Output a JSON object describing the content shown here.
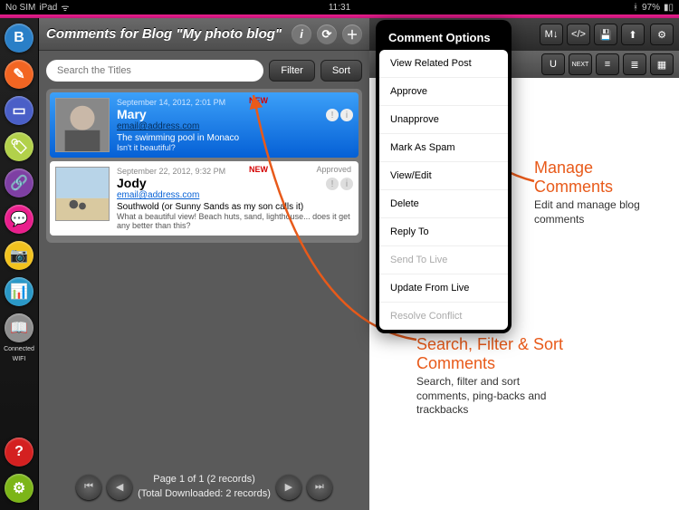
{
  "status": {
    "nosim": "No SIM",
    "time": "11:31",
    "battery": "97%"
  },
  "sidebar": {
    "items": [
      {
        "bg": "#2a7fc7",
        "char": "B"
      },
      {
        "bg": "#f26522",
        "char": "✎"
      },
      {
        "bg": "#4a5fc7",
        "char": "▭"
      },
      {
        "bg": "#b2d14a",
        "char": "🏷"
      },
      {
        "bg": "#7e3fa3",
        "char": "🔗"
      },
      {
        "bg": "#e91e8c",
        "char": "💬"
      },
      {
        "bg": "#f2c21e",
        "char": "📷"
      },
      {
        "bg": "#2a98c7",
        "char": "📊"
      },
      {
        "bg": "#8e8e8e",
        "char": "📖"
      }
    ],
    "connected": "Connected",
    "wifi": "WIFI",
    "help": "?",
    "settings": "⚙"
  },
  "header": {
    "title": "Comments for Blog \"My photo blog\""
  },
  "search": {
    "placeholder": "Search the Titles",
    "filter": "Filter",
    "sort": "Sort"
  },
  "comments": [
    {
      "date": "September 14, 2012, 2:01 PM",
      "author": "Mary",
      "email": "email@address.com",
      "title": "The swimming pool in Monaco",
      "text": "Isn't it beautiful?",
      "new": "NEW",
      "approved": "",
      "selected": true
    },
    {
      "date": "September 22, 2012, 9:32 PM",
      "author": "Jody",
      "email": "email@address.com",
      "title": "Southwold (or Sunny Sands as my son calls it)",
      "text": "What a beautiful view! Beach huts, sand, lighthouse... does it get any better than this?",
      "new": "NEW",
      "approved": "Approved",
      "selected": false
    }
  ],
  "pager": {
    "line1": "Page 1 of 1 (2 records)",
    "line2": "(Total Downloaded: 2 records)"
  },
  "popover": {
    "title": "Comment Options",
    "items": [
      {
        "label": "View Related Post",
        "disabled": false
      },
      {
        "label": "Approve",
        "disabled": false
      },
      {
        "label": "Unapprove",
        "disabled": false
      },
      {
        "label": "Mark As Spam",
        "disabled": false
      },
      {
        "label": "View/Edit",
        "disabled": false
      },
      {
        "label": "Delete",
        "disabled": false
      },
      {
        "label": "Reply To",
        "disabled": false
      },
      {
        "label": "Send To Live",
        "disabled": true
      },
      {
        "label": "Update From Live",
        "disabled": false
      },
      {
        "label": "Resolve Conflict",
        "disabled": true
      }
    ]
  },
  "annotations": {
    "a1": {
      "title": "Manage Comments",
      "body": "Edit and manage blog comments"
    },
    "a2": {
      "title": "Search, Filter & Sort Comments",
      "body": "Search, filter and sort comments, ping-backs and trackbacks"
    }
  },
  "toolbar": {
    "gear": "⚙",
    "md": "M↓",
    "code": "</>",
    "save": "💾",
    "up": "⬆"
  }
}
